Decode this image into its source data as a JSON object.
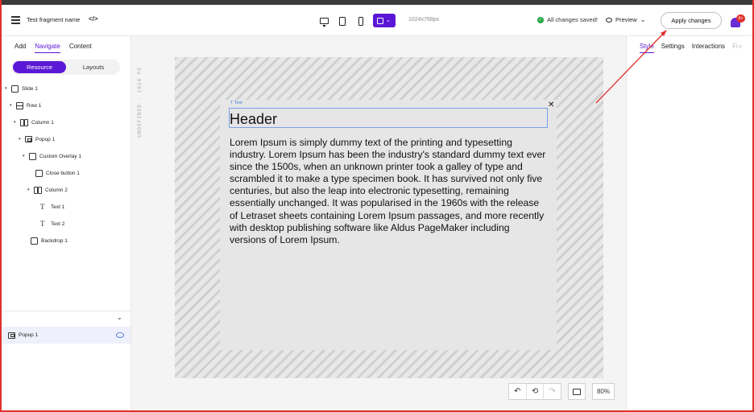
{
  "topbar": {
    "fragment_name": "Test fragment name",
    "code_icon": "code-icon",
    "resolution": "1024x768px",
    "saved_status": "All changes saved!",
    "preview_label": "Preview",
    "apply_label": "Apply changes",
    "notification_count": "9+",
    "accent": "#5b17d6"
  },
  "left_panel": {
    "tabs": [
      "Add",
      "Navigate",
      "Content"
    ],
    "active_tab": "Navigate",
    "segments": [
      "Resource",
      "Layouts"
    ],
    "tree": [
      {
        "label": "Slide 1",
        "icon": "slide-icon"
      },
      {
        "label": "Row 1",
        "icon": "row-icon"
      },
      {
        "label": "Column 1",
        "icon": "column-icon"
      },
      {
        "label": "Popup 1",
        "icon": "popup-icon"
      },
      {
        "label": "Custom Overlay 1",
        "icon": "overlay-icon"
      },
      {
        "label": "Close button 1",
        "icon": "button-icon"
      },
      {
        "label": "Column 2",
        "icon": "column-icon"
      },
      {
        "label": "Text 1",
        "icon": "text-icon"
      },
      {
        "label": "Text 2",
        "icon": "text-icon"
      },
      {
        "label": "Backdrop 1",
        "icon": "backdrop-icon"
      }
    ],
    "selected_layer": "Popup 1"
  },
  "canvas": {
    "ruler_label": "UNDEFINED · 1024 PX",
    "text_tag": "Text",
    "header": "Header",
    "close_glyph": "✕",
    "body": "Lorem Ipsum is simply dummy text of the printing and typesetting industry. Lorem Ipsum has been the industry's standard dummy text ever since the 1500s, when an unknown printer took a galley of type and scrambled it to make a type specimen book. It has survived not only five centuries, but also the leap into electronic typesetting, remaining essentially unchanged. It was popularised in the 1960s with the release of Letraset sheets containing Lorem Ipsum passages, and more recently with desktop publishing software like Aldus PageMaker including versions of Lorem Ipsum.",
    "zoom": "80%"
  },
  "right_panel": {
    "tabs": [
      "Style",
      "Settings",
      "Interactions",
      "Fi"
    ],
    "active_tab": "Style"
  }
}
